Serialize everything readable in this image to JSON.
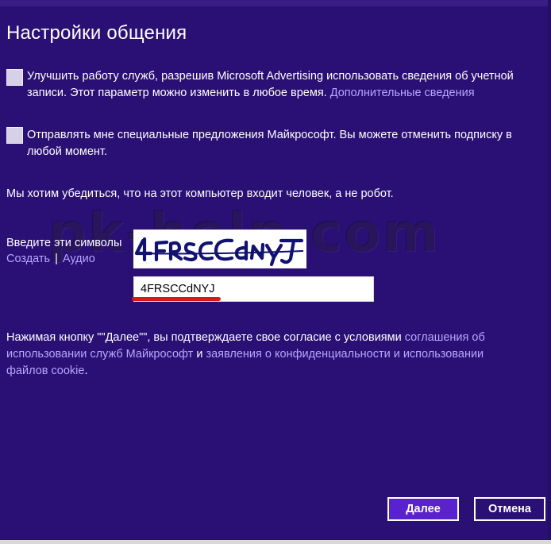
{
  "page": {
    "title": "Настройки общения"
  },
  "options": [
    {
      "text": "Улучшить работу служб, разрешив Microsoft Advertising использовать сведения об учетной записи. Этот параметр можно изменить в любое время.",
      "link": "Дополнительные сведения",
      "checked": false
    },
    {
      "text": "Отправлять мне специальные предложения Майкрософт. Вы можете отменить подписку в любой момент.",
      "link": "",
      "checked": false
    }
  ],
  "robot_check": {
    "text": "Мы хотим убедиться, что на этот компьютер входит человек, а не робот."
  },
  "watermark": "pk-help.com",
  "captcha": {
    "label": "Введите эти символы",
    "create_link": "Создать",
    "separator": "|",
    "audio_link": "Аудио",
    "image_text": "4FRSCCdNYJ",
    "input_value": "4FRSCCdNYJ"
  },
  "terms": {
    "text_start": "Нажимая кнопку \"\"Далее\"\", вы подтверждаете свое согласие с условиями",
    "link1": "соглашения об использовании служб Майкрософт",
    "conjunction": "и",
    "link2": "заявления о конфиденциальности и использовании файлов cookie",
    "end": "."
  },
  "buttons": {
    "next": "Далее",
    "cancel": "Отмена"
  },
  "colors": {
    "background": "#2a0f74",
    "link": "#b9a5ff",
    "primary_button": "#5a22cf",
    "annotation_red": "#d41a1a"
  }
}
